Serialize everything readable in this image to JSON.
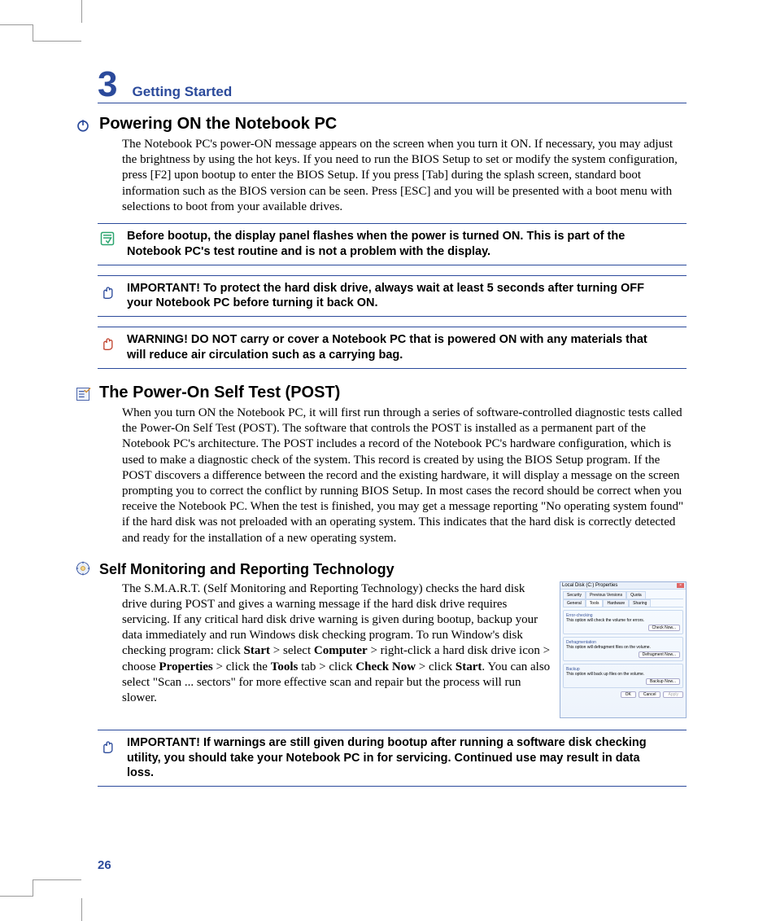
{
  "chapter": {
    "number": "3",
    "title": "Getting Started"
  },
  "section1": {
    "title": "Powering ON the Notebook PC",
    "body": "The Notebook PC's power-ON message appears on the screen when you turn it ON. If necessary, you may adjust the brightness by using the hot keys. If you need to run the BIOS Setup to set or modify the system configuration, press [F2] upon bootup to enter the BIOS Setup. If you press [Tab] during the splash screen, standard boot information such as the BIOS version can be seen. Press [ESC] and you will be presented with a boot menu with selections to boot from your available drives."
  },
  "callouts": {
    "note1": "Before bootup, the display panel flashes when the power is turned ON. This is part of the Notebook PC's test routine and is not a problem with the display.",
    "important1": "IMPORTANT!  To protect the hard disk drive, always wait at least 5 seconds after turning OFF your Notebook PC before turning it back ON.",
    "warning1": "WARNING! DO NOT carry or cover a Notebook PC that is powered ON with any materials that will reduce air circulation such as a carrying bag.",
    "important2": "IMPORTANT! If warnings are still given during bootup after running a software disk checking utility, you should take your Notebook PC in for servicing. Continued use may result in data loss."
  },
  "section2": {
    "title": "The Power-On Self Test (POST)",
    "body": "When you turn ON the Notebook PC, it will first run through a series of software-controlled diagnostic tests called the Power-On Self Test (POST). The software that controls the POST is installed as a permanent part of the Notebook PC's architecture. The POST includes a record of the Notebook PC's hardware configuration, which is used to make a diagnostic check of the system. This record is created by using the BIOS Setup program. If the POST discovers a difference between the record and the existing hardware, it will display a message on the screen prompting you to correct the conflict by running BIOS Setup. In most cases the record should be correct when you receive the Notebook PC. When the test is finished, you may get a message reporting \"No operating system found\" if the hard disk was not preloaded with an operating system. This indicates that the hard disk is correctly detected and ready for the installation of a new operating system."
  },
  "section3": {
    "title": "Self Monitoring and Reporting Technology",
    "body_parts": {
      "p0": "The S.M.A.R.T. (Self Monitoring and Reporting Technology) checks the hard disk drive during POST and gives a warning message if the hard disk drive requires servicing. If any critical hard disk drive warning is given during bootup, backup your data immediately and run Windows disk checking program. To run Window's disk checking program: click ",
      "b0": "Start",
      "p1": " > select ",
      "b1": "Computer",
      "p2": " > right-click a hard disk drive icon > choose ",
      "b2": "Properties",
      "p3": " > click the ",
      "b3": "Tools",
      "p4": " tab > click ",
      "b4": "Check Now",
      "p5": " > click ",
      "b5": "Start",
      "p6": ". You can also select \"Scan ... sectors\" for more effective scan and repair but the process will run slower."
    }
  },
  "dialog": {
    "title": "Local Disk (C:) Properties",
    "tabs_top": [
      "Security",
      "Previous Versions",
      "Quota"
    ],
    "tabs_bottom": [
      "General",
      "Tools",
      "Hardware",
      "Sharing"
    ],
    "boxes": {
      "err_label": "Error-checking",
      "err_text": "This option will check the volume for errors.",
      "err_btn": "Check Now...",
      "defrag_label": "Defragmentation",
      "defrag_text": "This option will defragment files on the volume.",
      "defrag_btn": "Defragment Now...",
      "backup_label": "Backup",
      "backup_text": "This option will back up files on the volume.",
      "backup_btn": "Backup Now..."
    },
    "btns": [
      "OK",
      "Cancel",
      "Apply"
    ]
  },
  "page_num": "26"
}
